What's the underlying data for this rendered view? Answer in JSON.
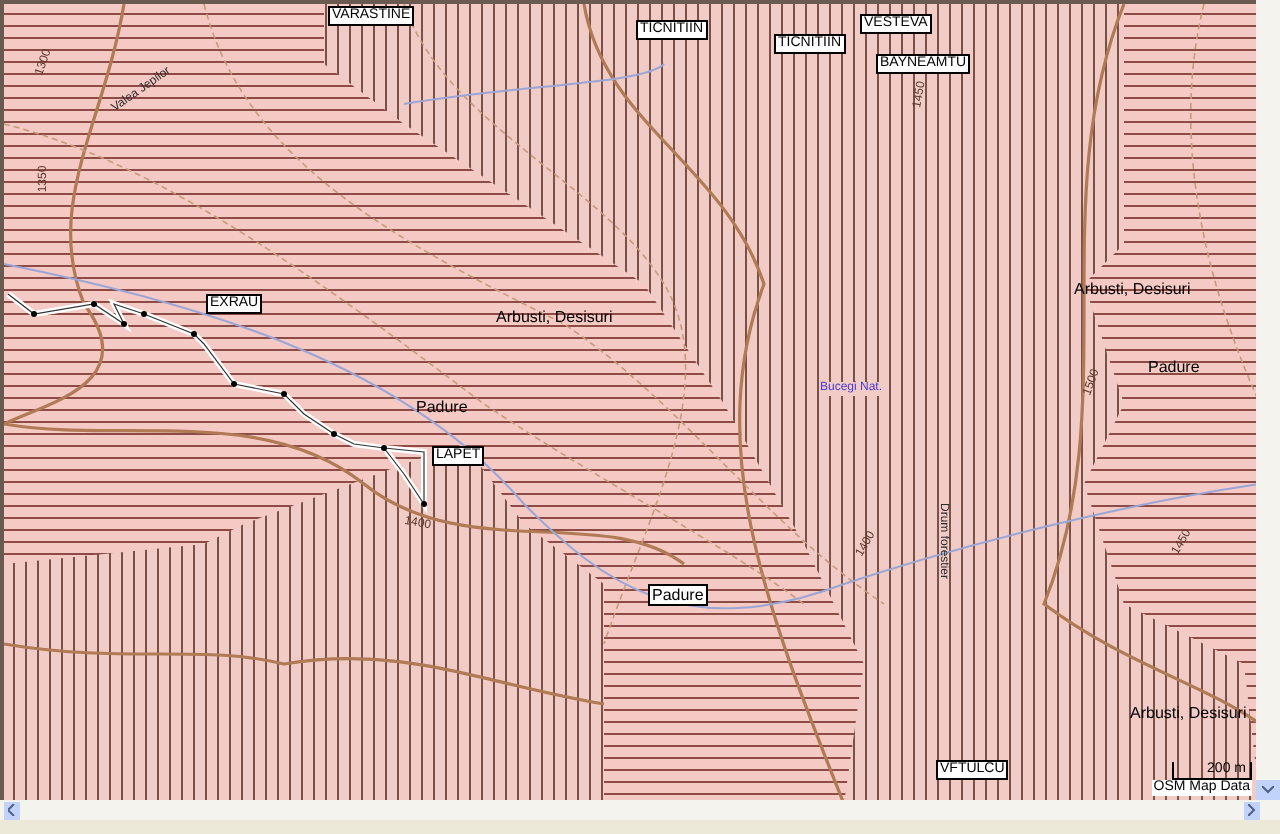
{
  "map": {
    "waypoints": [
      {
        "label": "VARASTINE"
      },
      {
        "label": "TICNITIIN"
      },
      {
        "label": "TICNITIIN"
      },
      {
        "label": "VESTEVA"
      },
      {
        "label": "BAYNEAMTU"
      },
      {
        "label": "EXRAU"
      },
      {
        "label": "LAPET"
      },
      {
        "label": "VFTULCU"
      }
    ],
    "area_labels": [
      {
        "text": "Arbusti, Desisuri",
        "boxed": false
      },
      {
        "text": "Padure",
        "boxed": false
      },
      {
        "text": "Arbusti, Desisuri",
        "boxed": false
      },
      {
        "text": "Padure",
        "boxed": false
      },
      {
        "text": "Padure",
        "boxed": true
      },
      {
        "text": "Arbusti, Desisuri",
        "boxed": false
      }
    ],
    "contour_labels": [
      "1300",
      "1350",
      "1400",
      "1450",
      "1500",
      "1400",
      "1450"
    ],
    "line_labels": [
      {
        "text": "Valea Jepilor",
        "kind": "road"
      },
      {
        "text": "Drum forestier",
        "kind": "road"
      },
      {
        "text": "Bucegi Nat.",
        "kind": "park"
      }
    ],
    "scale": {
      "distance": "200 m",
      "credit": "OSM Map Data"
    }
  }
}
